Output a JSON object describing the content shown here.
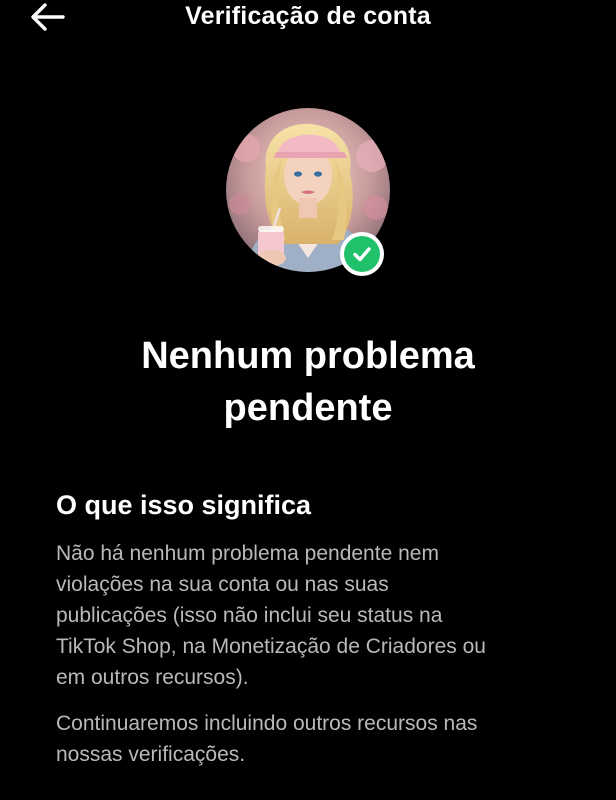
{
  "colors": {
    "background": "#000000",
    "accent": "#20c16b",
    "text_primary": "#ffffff",
    "text_secondary": "#b9b9b9"
  },
  "header": {
    "back_icon": "arrow-left-icon",
    "title": "Verificação de conta"
  },
  "profile": {
    "avatar_icon": "user-avatar",
    "badge_icon": "check-icon"
  },
  "status": {
    "headline_line1": "Nenhum problema",
    "headline_line2": "pendente"
  },
  "info": {
    "title": "O que isso significa",
    "paragraph1_lines": [
      "Não há nenhum problema pendente nem",
      "violações na sua conta ou nas suas",
      "publicações (isso não inclui seu status na",
      "TikTok Shop, na Monetização de Criadores ou",
      "em outros recursos)."
    ],
    "paragraph2_lines": [
      "Continuaremos incluindo outros recursos nas",
      "nossas verificações."
    ]
  }
}
